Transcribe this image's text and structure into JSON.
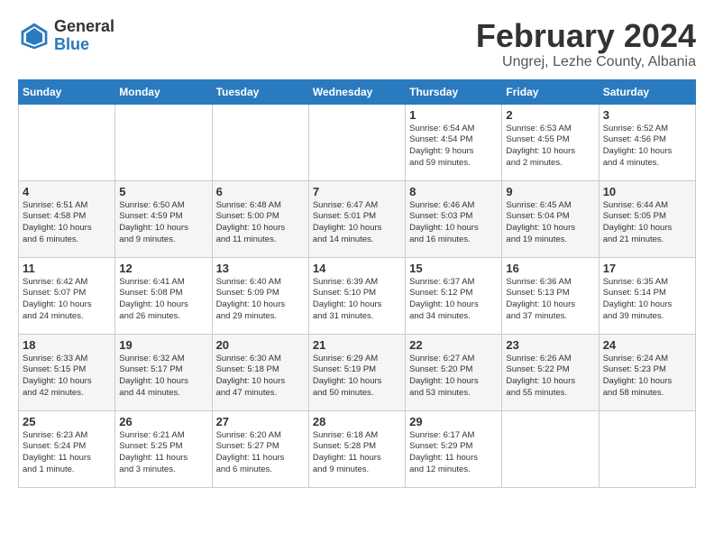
{
  "header": {
    "logo_general": "General",
    "logo_blue": "Blue",
    "month_year": "February 2024",
    "location": "Ungrej, Lezhe County, Albania"
  },
  "days_of_week": [
    "Sunday",
    "Monday",
    "Tuesday",
    "Wednesday",
    "Thursday",
    "Friday",
    "Saturday"
  ],
  "weeks": [
    [
      {
        "day": "",
        "info": ""
      },
      {
        "day": "",
        "info": ""
      },
      {
        "day": "",
        "info": ""
      },
      {
        "day": "",
        "info": ""
      },
      {
        "day": "1",
        "info": "Sunrise: 6:54 AM\nSunset: 4:54 PM\nDaylight: 9 hours\nand 59 minutes."
      },
      {
        "day": "2",
        "info": "Sunrise: 6:53 AM\nSunset: 4:55 PM\nDaylight: 10 hours\nand 2 minutes."
      },
      {
        "day": "3",
        "info": "Sunrise: 6:52 AM\nSunset: 4:56 PM\nDaylight: 10 hours\nand 4 minutes."
      }
    ],
    [
      {
        "day": "4",
        "info": "Sunrise: 6:51 AM\nSunset: 4:58 PM\nDaylight: 10 hours\nand 6 minutes."
      },
      {
        "day": "5",
        "info": "Sunrise: 6:50 AM\nSunset: 4:59 PM\nDaylight: 10 hours\nand 9 minutes."
      },
      {
        "day": "6",
        "info": "Sunrise: 6:48 AM\nSunset: 5:00 PM\nDaylight: 10 hours\nand 11 minutes."
      },
      {
        "day": "7",
        "info": "Sunrise: 6:47 AM\nSunset: 5:01 PM\nDaylight: 10 hours\nand 14 minutes."
      },
      {
        "day": "8",
        "info": "Sunrise: 6:46 AM\nSunset: 5:03 PM\nDaylight: 10 hours\nand 16 minutes."
      },
      {
        "day": "9",
        "info": "Sunrise: 6:45 AM\nSunset: 5:04 PM\nDaylight: 10 hours\nand 19 minutes."
      },
      {
        "day": "10",
        "info": "Sunrise: 6:44 AM\nSunset: 5:05 PM\nDaylight: 10 hours\nand 21 minutes."
      }
    ],
    [
      {
        "day": "11",
        "info": "Sunrise: 6:42 AM\nSunset: 5:07 PM\nDaylight: 10 hours\nand 24 minutes."
      },
      {
        "day": "12",
        "info": "Sunrise: 6:41 AM\nSunset: 5:08 PM\nDaylight: 10 hours\nand 26 minutes."
      },
      {
        "day": "13",
        "info": "Sunrise: 6:40 AM\nSunset: 5:09 PM\nDaylight: 10 hours\nand 29 minutes."
      },
      {
        "day": "14",
        "info": "Sunrise: 6:39 AM\nSunset: 5:10 PM\nDaylight: 10 hours\nand 31 minutes."
      },
      {
        "day": "15",
        "info": "Sunrise: 6:37 AM\nSunset: 5:12 PM\nDaylight: 10 hours\nand 34 minutes."
      },
      {
        "day": "16",
        "info": "Sunrise: 6:36 AM\nSunset: 5:13 PM\nDaylight: 10 hours\nand 37 minutes."
      },
      {
        "day": "17",
        "info": "Sunrise: 6:35 AM\nSunset: 5:14 PM\nDaylight: 10 hours\nand 39 minutes."
      }
    ],
    [
      {
        "day": "18",
        "info": "Sunrise: 6:33 AM\nSunset: 5:15 PM\nDaylight: 10 hours\nand 42 minutes."
      },
      {
        "day": "19",
        "info": "Sunrise: 6:32 AM\nSunset: 5:17 PM\nDaylight: 10 hours\nand 44 minutes."
      },
      {
        "day": "20",
        "info": "Sunrise: 6:30 AM\nSunset: 5:18 PM\nDaylight: 10 hours\nand 47 minutes."
      },
      {
        "day": "21",
        "info": "Sunrise: 6:29 AM\nSunset: 5:19 PM\nDaylight: 10 hours\nand 50 minutes."
      },
      {
        "day": "22",
        "info": "Sunrise: 6:27 AM\nSunset: 5:20 PM\nDaylight: 10 hours\nand 53 minutes."
      },
      {
        "day": "23",
        "info": "Sunrise: 6:26 AM\nSunset: 5:22 PM\nDaylight: 10 hours\nand 55 minutes."
      },
      {
        "day": "24",
        "info": "Sunrise: 6:24 AM\nSunset: 5:23 PM\nDaylight: 10 hours\nand 58 minutes."
      }
    ],
    [
      {
        "day": "25",
        "info": "Sunrise: 6:23 AM\nSunset: 5:24 PM\nDaylight: 11 hours\nand 1 minute."
      },
      {
        "day": "26",
        "info": "Sunrise: 6:21 AM\nSunset: 5:25 PM\nDaylight: 11 hours\nand 3 minutes."
      },
      {
        "day": "27",
        "info": "Sunrise: 6:20 AM\nSunset: 5:27 PM\nDaylight: 11 hours\nand 6 minutes."
      },
      {
        "day": "28",
        "info": "Sunrise: 6:18 AM\nSunset: 5:28 PM\nDaylight: 11 hours\nand 9 minutes."
      },
      {
        "day": "29",
        "info": "Sunrise: 6:17 AM\nSunset: 5:29 PM\nDaylight: 11 hours\nand 12 minutes."
      },
      {
        "day": "",
        "info": ""
      },
      {
        "day": "",
        "info": ""
      }
    ]
  ]
}
